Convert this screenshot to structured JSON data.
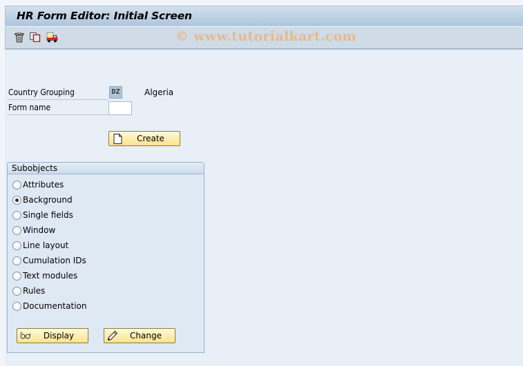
{
  "window": {
    "title": "HR Form Editor: Initial Screen"
  },
  "toolbar": {
    "icons": [
      {
        "name": "delete",
        "icon": "trash-icon"
      },
      {
        "name": "copy",
        "icon": "copy-icon"
      },
      {
        "name": "transport",
        "icon": "truck-icon"
      }
    ],
    "watermark": "© www.tutorialkart.com"
  },
  "form": {
    "country_grouping": {
      "label": "Country Grouping",
      "value": "DZ",
      "description": "Algeria"
    },
    "form_name": {
      "label": "Form name",
      "value": ""
    },
    "create_button": "Create"
  },
  "subobjects": {
    "title": "Subobjects",
    "options": [
      {
        "label": "Attributes",
        "checked": false
      },
      {
        "label": "Background",
        "checked": true
      },
      {
        "label": "Single fields",
        "checked": false
      },
      {
        "label": "Window",
        "checked": false
      },
      {
        "label": "Line layout",
        "checked": false
      },
      {
        "label": "Cumulation IDs",
        "checked": false
      },
      {
        "label": "Text modules",
        "checked": false
      },
      {
        "label": "Rules",
        "checked": false
      },
      {
        "label": "Documentation",
        "checked": false
      }
    ],
    "display_button": "Display",
    "change_button": "Change"
  }
}
